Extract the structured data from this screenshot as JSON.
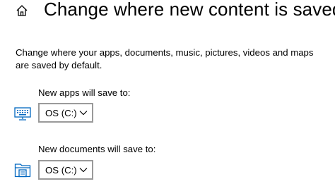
{
  "header": {
    "title": "Change where new content is saved",
    "home_icon": "home-icon"
  },
  "description": "Change where your apps, documents, music, pictures, videos and maps are saved by default.",
  "settings": [
    {
      "label": "New apps will save to:",
      "value": "OS (C:)",
      "icon": "monitor-keyboard-icon"
    },
    {
      "label": "New documents will save to:",
      "value": "OS (C:)",
      "icon": "folder-document-icon"
    }
  ],
  "colors": {
    "accent": "#0067c0",
    "dropdown_border": "#9a9a9a"
  }
}
